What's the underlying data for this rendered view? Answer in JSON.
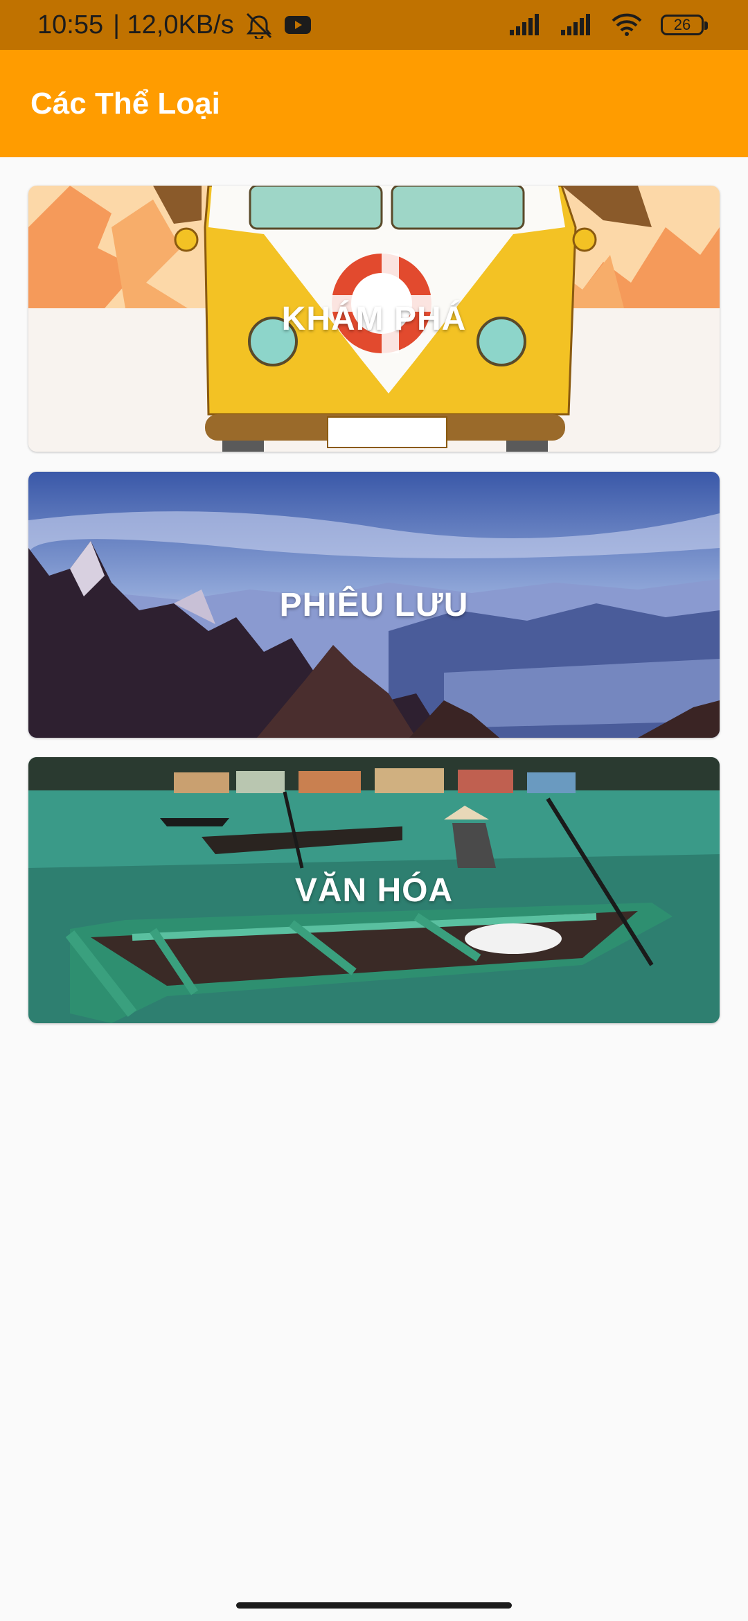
{
  "status_bar": {
    "time": "10:55",
    "network_speed": "| 12,0KB/s",
    "battery_level": "26",
    "icons": [
      "alarm-off-icon",
      "youtube-icon",
      "signal-icon",
      "signal-icon",
      "wifi-icon",
      "battery-icon"
    ]
  },
  "app_bar": {
    "title": "Các Thể Loại",
    "color": "#ff9c00"
  },
  "categories": [
    {
      "label": "KHÁM PHÁ",
      "image": "yellow van cartoon"
    },
    {
      "label": "PHIÊU LƯU",
      "image": "mountain landscape"
    },
    {
      "label": "VĂN HÓA",
      "image": "boats on bay"
    }
  ],
  "colors": {
    "status_bar": "#c07200",
    "accent": "#ff9c00",
    "background": "#fafafa"
  }
}
